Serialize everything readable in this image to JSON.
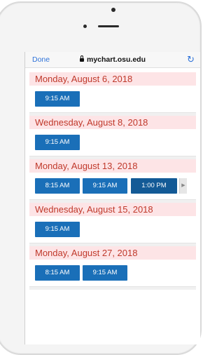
{
  "browser": {
    "done_label": "Done",
    "url": "mychart.osu.edu",
    "reload_icon": "reload-icon"
  },
  "days": [
    {
      "label": "Monday, August 6, 2018",
      "slots": [
        "9:15 AM"
      ]
    },
    {
      "label": "Wednesday, August 8, 2018",
      "slots": [
        "9:15 AM"
      ]
    },
    {
      "label": "Monday, August 13, 2018",
      "slots": [
        "8:15 AM",
        "9:15 AM",
        "1:00 PM"
      ]
    },
    {
      "label": "Wednesday, August 15, 2018",
      "slots": [
        "9:15 AM"
      ]
    },
    {
      "label": "Monday, August 27, 2018",
      "slots": [
        "8:15 AM",
        "9:15 AM"
      ]
    }
  ],
  "colors": {
    "accent_blue": "#1a6fb8",
    "date_red": "#c0392b",
    "header_pink": "#fde4e6",
    "link_blue": "#2f73d9"
  }
}
